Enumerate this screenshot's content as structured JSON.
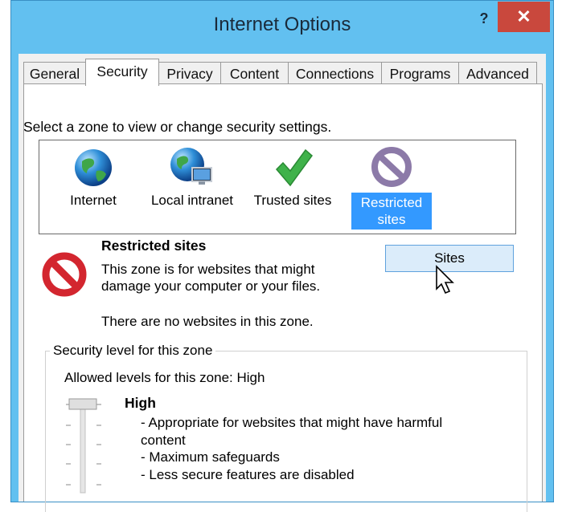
{
  "window": {
    "title": "Internet Options",
    "help_label": "?",
    "close_label": "✕"
  },
  "tabs": [
    {
      "label": "General"
    },
    {
      "label": "Security",
      "active": true
    },
    {
      "label": "Privacy"
    },
    {
      "label": "Content"
    },
    {
      "label": "Connections"
    },
    {
      "label": "Programs"
    },
    {
      "label": "Advanced"
    }
  ],
  "security": {
    "zone_caption": "Select a zone to view or change security settings.",
    "zones": [
      {
        "label": "Internet",
        "icon": "globe-icon"
      },
      {
        "label": "Local intranet",
        "icon": "intranet-globe-icon"
      },
      {
        "label": "Trusted sites",
        "icon": "checkmark-icon"
      },
      {
        "label_line1": "Restricted",
        "label_line2": "sites",
        "icon": "restricted-icon",
        "selected": true
      }
    ],
    "selected_zone": {
      "title": "Restricted sites",
      "description_line1": "This zone is for websites that might",
      "description_line2": "damage your computer or your files.",
      "empty_text": "There are no websites in this zone."
    },
    "sites_button": "Sites",
    "level_group": {
      "legend": "Security level for this zone",
      "allowed": "Allowed levels for this zone: High",
      "level_name": "High",
      "bullets": [
        "- Appropriate for websites that might have harmful",
        "content",
        "- Maximum safeguards",
        "- Less secure features are disabled"
      ]
    }
  },
  "colors": {
    "titlebar": "#62c0f0",
    "close": "#c9483d",
    "selection": "#3399ff",
    "button_hover": "#dbecfa"
  }
}
